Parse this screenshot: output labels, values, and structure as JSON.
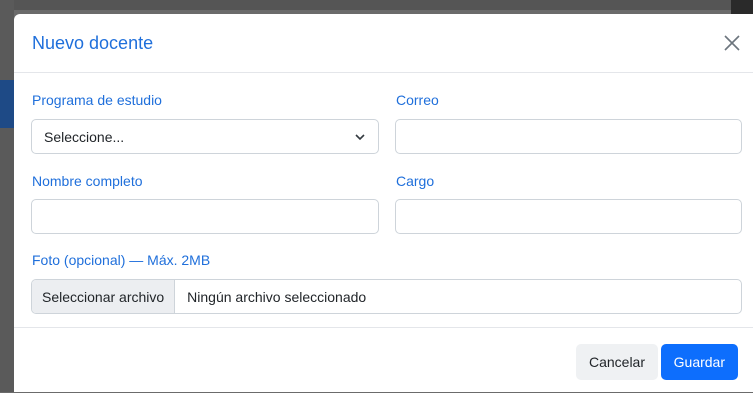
{
  "modal": {
    "title": "Nuevo docente",
    "close_label": "×"
  },
  "form": {
    "programa": {
      "label": "Programa de estudio",
      "selected": "Seleccione..."
    },
    "correo": {
      "label": "Correo",
      "value": "",
      "placeholder": ""
    },
    "nombre": {
      "label": "Nombre completo",
      "value": "",
      "placeholder": ""
    },
    "cargo": {
      "label": "Cargo",
      "value": "",
      "placeholder": ""
    },
    "foto": {
      "label": "Foto (opcional) — Máx. 2MB",
      "button_label": "Seleccionar archivo",
      "status_text": "Ningún archivo seleccionado"
    }
  },
  "footer": {
    "cancel_label": "Cancelar",
    "save_label": "Guardar"
  },
  "colors": {
    "accent": "#1f6fdb",
    "primary_button": "#0d6efd",
    "secondary_button": "#eff1f3"
  },
  "icons": {
    "close": "close-icon",
    "select": "chevron-down-icon"
  }
}
